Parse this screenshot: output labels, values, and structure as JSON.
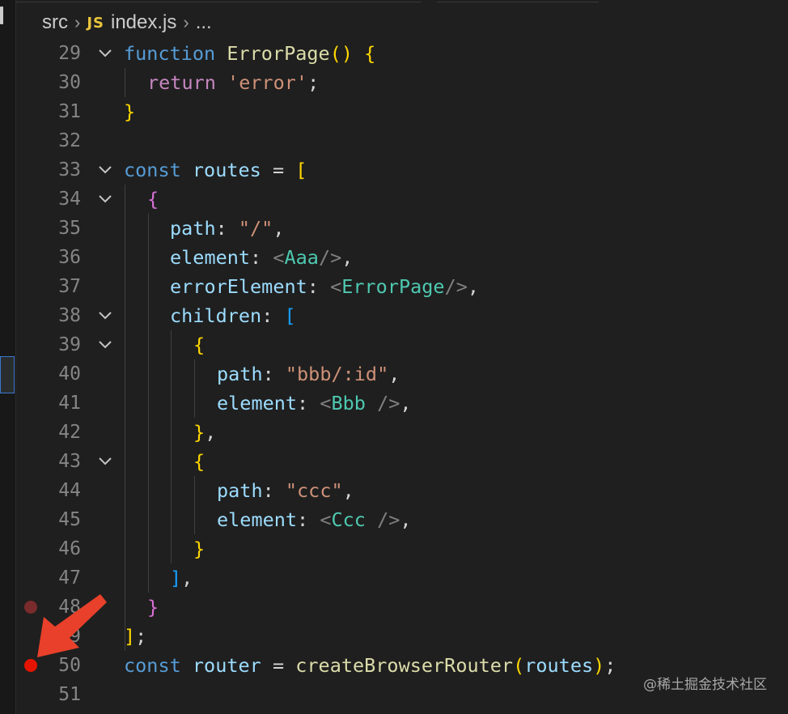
{
  "breadcrumb": {
    "folder": "src",
    "file_badge": "JS",
    "file": "index.js",
    "ellipsis": "..."
  },
  "lines": [
    {
      "n": "29",
      "fold": true
    },
    {
      "n": "30",
      "fold": false
    },
    {
      "n": "31",
      "fold": false
    },
    {
      "n": "32",
      "fold": false
    },
    {
      "n": "33",
      "fold": true
    },
    {
      "n": "34",
      "fold": true
    },
    {
      "n": "35",
      "fold": false
    },
    {
      "n": "36",
      "fold": false
    },
    {
      "n": "37",
      "fold": false
    },
    {
      "n": "38",
      "fold": true
    },
    {
      "n": "39",
      "fold": true
    },
    {
      "n": "40",
      "fold": false
    },
    {
      "n": "41",
      "fold": false
    },
    {
      "n": "42",
      "fold": false
    },
    {
      "n": "43",
      "fold": true
    },
    {
      "n": "44",
      "fold": false
    },
    {
      "n": "45",
      "fold": false
    },
    {
      "n": "46",
      "fold": false
    },
    {
      "n": "47",
      "fold": false
    },
    {
      "n": "48",
      "fold": false
    },
    {
      "n": "49",
      "fold": false
    },
    {
      "n": "50",
      "fold": false
    },
    {
      "n": "51",
      "fold": false
    }
  ],
  "code": {
    "l29": {
      "kw": "function",
      "name": "ErrorPage",
      "paren": "()",
      "brace": "{"
    },
    "l30": {
      "kw": "return",
      "str": "'error'",
      "semi": ";"
    },
    "l31": {
      "brace": "}"
    },
    "l33": {
      "kw": "const",
      "name": "routes",
      "eq": " = ",
      "bracket": "["
    },
    "l34": {
      "brace": "{"
    },
    "l35": {
      "key": "path",
      "colon": ": ",
      "str": "\"/\"",
      "comma": ","
    },
    "l36": {
      "key": "element",
      "colon": ": ",
      "open": "<",
      "tag": "Aaa",
      "close": "/>",
      "comma": ","
    },
    "l37": {
      "key": "errorElement",
      "colon": ": ",
      "open": "<",
      "tag": "ErrorPage",
      "close": "/>",
      "comma": ","
    },
    "l38": {
      "key": "children",
      "colon": ": ",
      "bracket": "["
    },
    "l39": {
      "brace": "{"
    },
    "l40": {
      "key": "path",
      "colon": ": ",
      "str": "\"bbb/:id\"",
      "comma": ","
    },
    "l41": {
      "key": "element",
      "colon": ": ",
      "open": "<",
      "tag": "Bbb",
      "close": " />",
      "comma": ","
    },
    "l42": {
      "brace": "}",
      "comma": ","
    },
    "l43": {
      "brace": "{"
    },
    "l44": {
      "key": "path",
      "colon": ": ",
      "str": "\"ccc\"",
      "comma": ","
    },
    "l45": {
      "key": "element",
      "colon": ": ",
      "open": "<",
      "tag": "Ccc",
      "close": " />",
      "comma": ","
    },
    "l46": {
      "brace": "}"
    },
    "l47": {
      "bracket": "]",
      "comma": ","
    },
    "l48": {
      "brace": "}"
    },
    "l49": {
      "bracket": "]",
      "semi": ";"
    },
    "l50": {
      "kw": "const",
      "name": "router",
      "eq": " = ",
      "fn": "createBrowserRouter",
      "open": "(",
      "arg": "routes",
      "close": ")",
      "semi": ";"
    }
  },
  "breakpoints": [
    {
      "line": "48",
      "color": "#7a2b2b"
    },
    {
      "line": "50",
      "color": "#e51400"
    }
  ],
  "colors": {
    "background": "#1f1f1f",
    "keyword_blue": "#569cd6",
    "keyword_purple": "#c586c0",
    "function": "#dcdcaa",
    "variable": "#9cdcfe",
    "string": "#ce9178",
    "jsx_tag": "#4ec9b0",
    "bracket_gold": "#ffd700",
    "bracket_orchid": "#da70d6",
    "bracket_blue": "#179fff",
    "arrow": "#e8402a"
  },
  "icons": {
    "fold": "chevron-down-icon",
    "breadcrumb_sep": "chevron-right-icon",
    "annotation": "red-arrow-icon"
  },
  "watermark": "@稀土掘金技术社区"
}
